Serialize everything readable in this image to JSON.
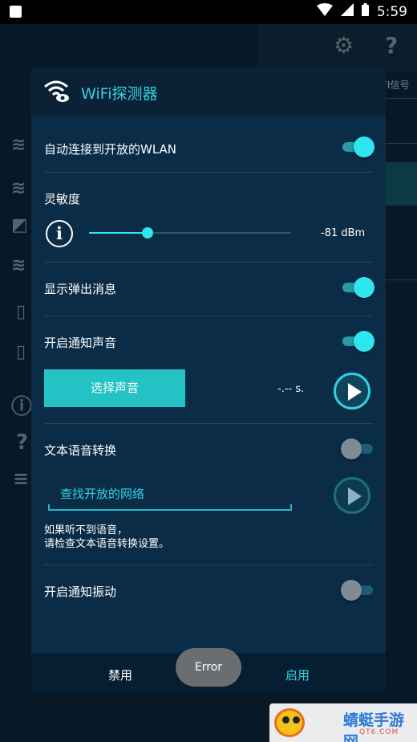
{
  "status_bar": {
    "time": "5:59"
  },
  "dialog": {
    "title": "WiFi探测器",
    "auto_connect_label": "自动连接到开放的WLAN",
    "auto_connect_on": true,
    "sensitivity_label": "灵敏度",
    "sensitivity_value": "-81 dBm",
    "sensitivity_level_percent": 29,
    "show_popup_label": "显示弹出消息",
    "show_popup_on": true,
    "notify_sound_label": "开启通知声音",
    "notify_sound_on": true,
    "choose_sound_label": "选择声音",
    "sound_duration": "-.-- s.",
    "tts_label": "文本语音转换",
    "tts_on": false,
    "tts_text": "查找开放的网络",
    "tts_note_line1": "如果听不到语音，",
    "tts_note_line2": "请检查文本语音转换设置。",
    "vibrate_label": "开启通知振动",
    "vibrate_on": false,
    "disable_label": "禁用",
    "enable_label": "启用"
  },
  "toast": "Error",
  "background": {
    "partial_text": "FI信号"
  },
  "watermark": {
    "main": "蜻蜓手游网",
    "sub": "QT6.COM"
  },
  "colors": {
    "accent": "#2ee5f0",
    "button": "#23c2c5",
    "dialog_bg": "#0a2c47",
    "title_text": "#32d1e4"
  }
}
